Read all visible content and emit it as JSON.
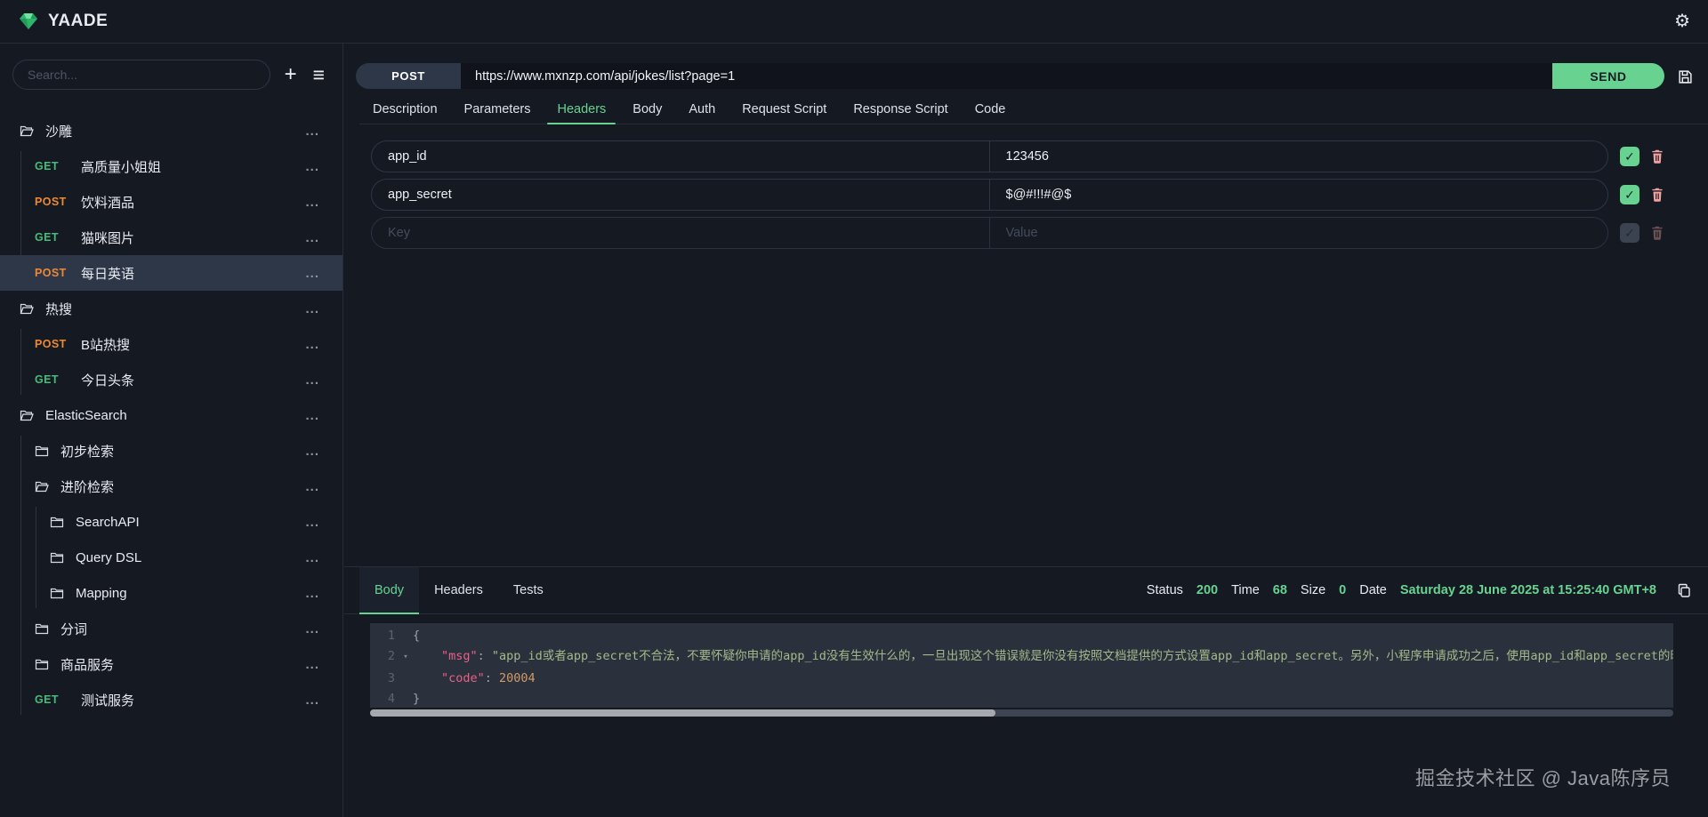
{
  "topbar": {
    "title": "YAADE"
  },
  "colors": {
    "accent_green": "#68d391",
    "get_method": "#48bb78",
    "post_method": "#ed8936",
    "checkbox_green": "#68d391",
    "trash_red": "#f3a0a0",
    "json_key": "#e8608a",
    "json_string": "#a3b98a",
    "json_number": "#d19a66"
  },
  "icons": {
    "logo": "gem",
    "settings": "gear",
    "add": "plus",
    "collections_menu": "hamburger",
    "save": "floppy-disk",
    "copy": "copy",
    "delete": "trash",
    "enabled": "checkmark",
    "row_menu": "ellipsis",
    "fold": "chevron-down",
    "folder": "folder"
  },
  "sidebar": {
    "search_placeholder": "Search...",
    "tree": [
      {
        "type": "folder",
        "label": "沙雕",
        "open": true,
        "children": [
          {
            "type": "request",
            "method": "GET",
            "label": "高质量小姐姐"
          },
          {
            "type": "request",
            "method": "POST",
            "label": "饮料酒品"
          },
          {
            "type": "request",
            "method": "GET",
            "label": "猫咪图片"
          },
          {
            "type": "request",
            "method": "POST",
            "label": "每日英语",
            "selected": true
          }
        ]
      },
      {
        "type": "folder",
        "label": "热搜",
        "open": true,
        "children": [
          {
            "type": "request",
            "method": "POST",
            "label": "B站热搜"
          },
          {
            "type": "request",
            "method": "GET",
            "label": "今日头条"
          }
        ]
      },
      {
        "type": "folder",
        "label": "ElasticSearch",
        "open": true,
        "children": [
          {
            "type": "folder",
            "label": "初步检索",
            "open": false
          },
          {
            "type": "folder",
            "label": "进阶检索",
            "open": true,
            "children": [
              {
                "type": "folder",
                "label": "SearchAPI",
                "open": false
              },
              {
                "type": "folder",
                "label": "Query DSL",
                "open": false
              },
              {
                "type": "folder",
                "label": "Mapping",
                "open": false
              }
            ]
          },
          {
            "type": "folder",
            "label": "分词",
            "open": false
          },
          {
            "type": "folder",
            "label": "商品服务",
            "open": false
          },
          {
            "type": "request",
            "method": "GET",
            "label": "测试服务"
          }
        ]
      }
    ]
  },
  "request": {
    "method": "POST",
    "url": "https://www.mxnzp.com/api/jokes/list?page=1",
    "send_label": "SEND",
    "tabs": [
      "Description",
      "Parameters",
      "Headers",
      "Body",
      "Auth",
      "Request Script",
      "Response Script",
      "Code"
    ],
    "active_tab": "Headers",
    "header_rows": [
      {
        "key": "app_id",
        "value": "123456",
        "enabled": true,
        "empty": false
      },
      {
        "key": "app_secret",
        "value": "$@#!!!#@$",
        "enabled": true,
        "empty": false
      },
      {
        "key": "",
        "value": "",
        "key_placeholder": "Key",
        "value_placeholder": "Value",
        "enabled": false,
        "empty": true
      }
    ]
  },
  "response": {
    "tabs": [
      "Body",
      "Headers",
      "Tests"
    ],
    "active_tab": "Body",
    "meta": [
      {
        "label": "Status",
        "value": "200"
      },
      {
        "label": "Time",
        "value": "68"
      },
      {
        "label": "Size",
        "value": "0"
      },
      {
        "label": "Date",
        "value": "Saturday 28 June 2025 at 15:25:40 GMT+8"
      }
    ],
    "body_lines": [
      {
        "num": "1",
        "fold": false,
        "indent": 0,
        "tokens": [
          {
            "t": "punct",
            "v": "{"
          }
        ]
      },
      {
        "num": "2",
        "fold": true,
        "indent": 1,
        "tokens": [
          {
            "t": "key",
            "v": "\"msg\""
          },
          {
            "t": "punct",
            "v": ": "
          },
          {
            "t": "str",
            "v": "\"app_id或者app_secret不合法，不要怀疑你申请的app_id没有生效什么的，一旦出现这个错误就是你没有按照文档提供的方式设置app_id和app_secret。另外，小程序申请成功之后，使用app_id和app_secret的时候不要"
          }
        ]
      },
      {
        "num": "3",
        "fold": false,
        "indent": 1,
        "tokens": [
          {
            "t": "key",
            "v": "\"code\""
          },
          {
            "t": "punct",
            "v": ": "
          },
          {
            "t": "num",
            "v": "20004"
          }
        ]
      },
      {
        "num": "4",
        "fold": false,
        "indent": 0,
        "tokens": [
          {
            "t": "punct",
            "v": "}"
          }
        ]
      }
    ],
    "scrollbar_thumb_percent": 48
  },
  "watermark": "掘金技术社区 @ Java陈序员"
}
